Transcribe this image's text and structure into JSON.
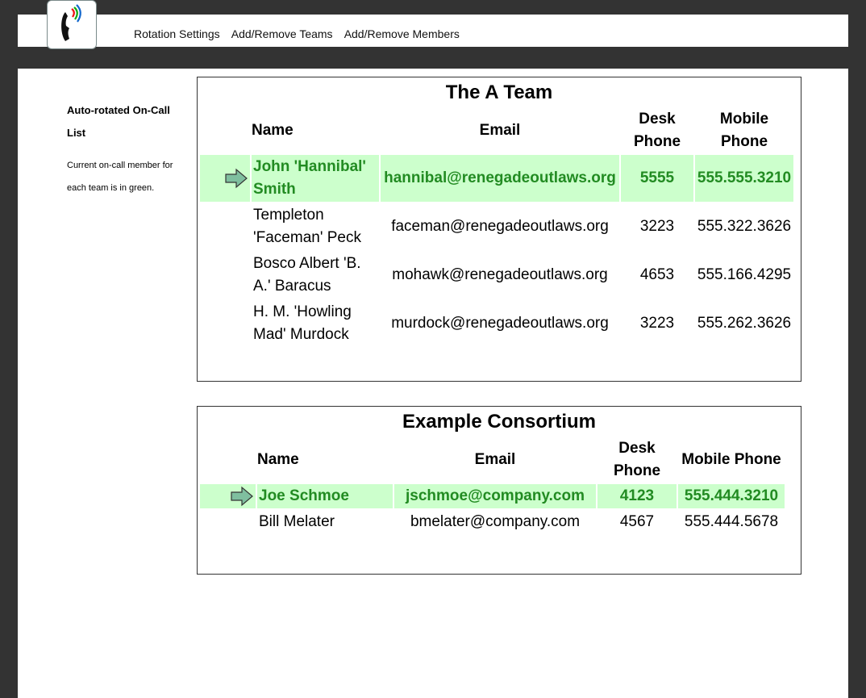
{
  "nav": {
    "items": [
      "Rotation Settings",
      "Add/Remove Teams",
      "Add/Remove Members"
    ]
  },
  "sidebar": {
    "title": "Auto-rotated On-Call List",
    "note": "Current on-call member for each team is in green."
  },
  "colors": {
    "oncall_bg": "#ccffcc",
    "oncall_text": "#228b22"
  },
  "teams": [
    {
      "title": "The A Team",
      "headers": {
        "name": "Name",
        "email": "Email",
        "desk": "Desk Phone",
        "mobile": "Mobile Phone"
      },
      "members": [
        {
          "name": "John 'Hannibal' Smith",
          "email": "hannibal@renegadeoutlaws.org",
          "desk": "5555",
          "mobile": "555.555.3210",
          "oncall": true
        },
        {
          "name": "Templeton 'Faceman' Peck",
          "email": "faceman@renegadeoutlaws.org",
          "desk": "3223",
          "mobile": "555.322.3626"
        },
        {
          "name": "Bosco Albert 'B. A.' Baracus",
          "email": "mohawk@renegadeoutlaws.org",
          "desk": "4653",
          "mobile": "555.166.4295"
        },
        {
          "name": "H. M. 'Howling Mad' Murdock",
          "email": "murdock@renegadeoutlaws.org",
          "desk": "3223",
          "mobile": "555.262.3626"
        }
      ]
    },
    {
      "title": "Example Consortium",
      "headers": {
        "name": "Name",
        "email": "Email",
        "desk": "Desk Phone",
        "mobile": "Mobile Phone"
      },
      "members": [
        {
          "name": "Joe Schmoe",
          "email": "jschmoe@company.com",
          "desk": "4123",
          "mobile": "555.444.3210",
          "oncall": true
        },
        {
          "name": "Bill Melater",
          "email": "bmelater@company.com",
          "desk": "4567",
          "mobile": "555.444.5678"
        }
      ]
    }
  ]
}
